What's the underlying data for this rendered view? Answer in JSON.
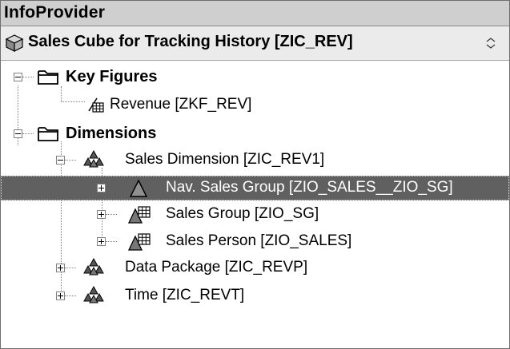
{
  "panel": {
    "title": "InfoProvider"
  },
  "header": {
    "title": "Sales Cube for Tracking History [ZIC_REV]"
  },
  "tree": {
    "key_figures": {
      "label": "Key Figures"
    },
    "revenue": {
      "label": "Revenue [ZKF_REV]"
    },
    "dimensions": {
      "label": "Dimensions"
    },
    "sales_dimension": {
      "label": "Sales Dimension [ZIC_REV1]"
    },
    "nav_sales_group": {
      "label": "Nav. Sales Group [ZIO_SALES__ZIO_SG]"
    },
    "sales_group": {
      "label": "Sales Group [ZIO_SG]"
    },
    "sales_person": {
      "label": "Sales Person [ZIO_SALES]"
    },
    "data_package": {
      "label": "Data Package [ZIC_REVP]"
    },
    "time": {
      "label": "Time [ZIC_REVT]"
    }
  },
  "colors": {
    "selected_row": "#606060",
    "titlebar": "#cfcfcf"
  }
}
